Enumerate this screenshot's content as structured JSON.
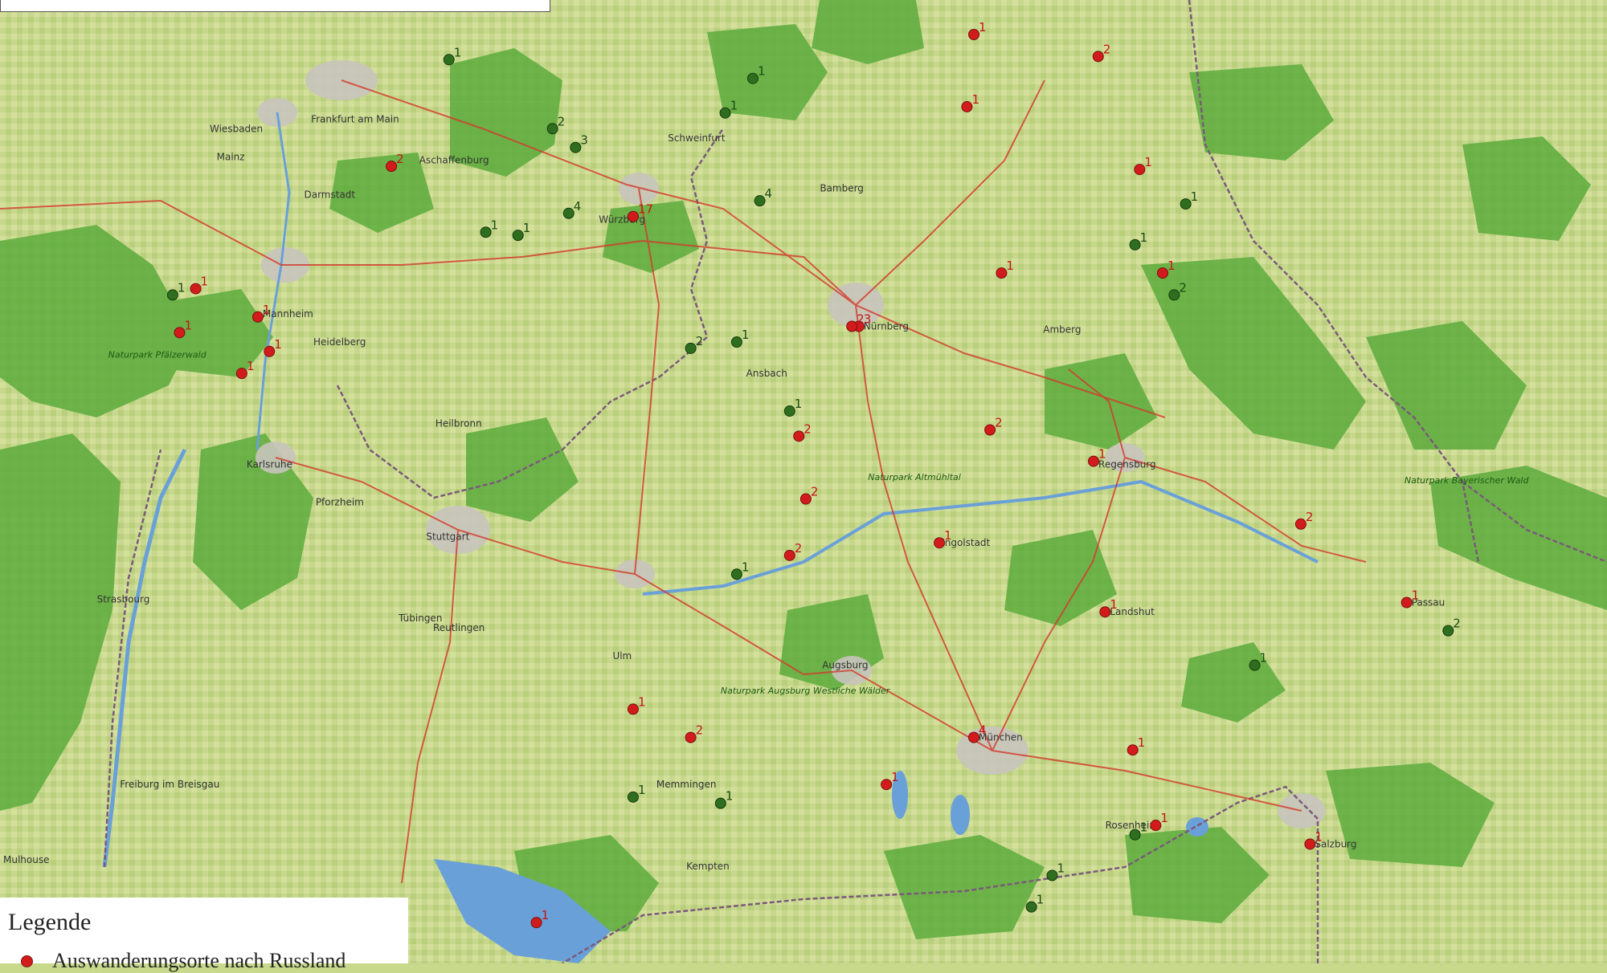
{
  "colors": {
    "russia_marker": "#d21c1c",
    "other_marker": "#2e6e1e",
    "forest": "#5cab3c",
    "farmland": "#c4d68a",
    "lake": "#6aa0d8",
    "road": "#d33a2c",
    "border": "#7a5a7a"
  },
  "legend": {
    "title": "Legende",
    "items": [
      {
        "label": "Auswanderungsorte nach Russland",
        "color": "#d21c1c"
      }
    ]
  },
  "places": [
    {
      "name": "Frankfurt am Main"
    },
    {
      "name": "Wiesbaden"
    },
    {
      "name": "Mainz"
    },
    {
      "name": "Darmstadt"
    },
    {
      "name": "Mannheim"
    },
    {
      "name": "Heidelberg"
    },
    {
      "name": "Karlsruhe"
    },
    {
      "name": "Pforzheim"
    },
    {
      "name": "Stuttgart"
    },
    {
      "name": "Heilbronn"
    },
    {
      "name": "Reutlingen"
    },
    {
      "name": "Tübingen"
    },
    {
      "name": "Strasbourg"
    },
    {
      "name": "Freiburg im Breisgau"
    },
    {
      "name": "Mulhouse"
    },
    {
      "name": "Ulm"
    },
    {
      "name": "Augsburg"
    },
    {
      "name": "München"
    },
    {
      "name": "Ingolstadt"
    },
    {
      "name": "Regensburg"
    },
    {
      "name": "Nürnberg"
    },
    {
      "name": "Würzburg"
    },
    {
      "name": "Bamberg"
    },
    {
      "name": "Landshut"
    },
    {
      "name": "Passau"
    },
    {
      "name": "Salzburg"
    },
    {
      "name": "Kempten"
    },
    {
      "name": "Memmingen"
    },
    {
      "name": "Rosenheim"
    },
    {
      "name": "Amberg"
    },
    {
      "name": "Schweinfurt"
    },
    {
      "name": "Aschaffenburg"
    },
    {
      "name": "Ansbach"
    }
  ],
  "area_labels": [
    {
      "name": "Naturpark Pfälzerwald"
    },
    {
      "name": "Naturpark Altmühltal"
    },
    {
      "name": "Naturpark Bayerischer Wald"
    },
    {
      "name": "Naturpark Augsburg Westliche Wälder"
    }
  ],
  "markers": [
    {
      "kind": "russia",
      "count": 17,
      "x": 10.1,
      "y": 49.8
    },
    {
      "kind": "russia",
      "count": 4,
      "x": 11.58,
      "y": 48.14
    },
    {
      "kind": "russia",
      "count": 3,
      "x": 11.08,
      "y": 49.45
    },
    {
      "kind": "russia",
      "count": 2,
      "x": 11.05,
      "y": 49.45
    },
    {
      "kind": "russia",
      "count": 2,
      "x": 9.05,
      "y": 49.96
    },
    {
      "kind": "russia",
      "count": 2,
      "x": 12.12,
      "y": 50.31
    },
    {
      "kind": "russia",
      "count": 2,
      "x": 11.65,
      "y": 49.12
    },
    {
      "kind": "russia",
      "count": 2,
      "x": 10.78,
      "y": 48.72
    },
    {
      "kind": "russia",
      "count": 2,
      "x": 13.0,
      "y": 48.82
    },
    {
      "kind": "russia",
      "count": 2,
      "x": 10.35,
      "y": 48.14
    },
    {
      "kind": "russia",
      "count": 2,
      "x": 10.85,
      "y": 48.9
    },
    {
      "kind": "russia",
      "count": 2,
      "x": 10.82,
      "y": 49.1
    },
    {
      "kind": "russia",
      "count": 1,
      "x": 8.47,
      "y": 49.48
    },
    {
      "kind": "russia",
      "count": 1,
      "x": 8.2,
      "y": 49.57
    },
    {
      "kind": "russia",
      "count": 1,
      "x": 8.4,
      "y": 49.3
    },
    {
      "kind": "russia",
      "count": 1,
      "x": 8.13,
      "y": 49.43
    },
    {
      "kind": "russia",
      "count": 1,
      "x": 8.52,
      "y": 49.37
    },
    {
      "kind": "russia",
      "count": 1,
      "x": 12.1,
      "y": 49.02
    },
    {
      "kind": "russia",
      "count": 1,
      "x": 11.43,
      "y": 48.76
    },
    {
      "kind": "russia",
      "count": 1,
      "x": 12.15,
      "y": 48.54
    },
    {
      "kind": "russia",
      "count": 1,
      "x": 13.46,
      "y": 48.57
    },
    {
      "kind": "russia",
      "count": 1,
      "x": 13.04,
      "y": 47.8
    },
    {
      "kind": "russia",
      "count": 1,
      "x": 9.68,
      "y": 47.55
    },
    {
      "kind": "russia",
      "count": 1,
      "x": 12.37,
      "y": 47.86
    },
    {
      "kind": "russia",
      "count": 1,
      "x": 12.27,
      "y": 48.1
    },
    {
      "kind": "russia",
      "count": 1,
      "x": 10.1,
      "y": 48.23
    },
    {
      "kind": "russia",
      "count": 1,
      "x": 11.7,
      "y": 49.62
    },
    {
      "kind": "russia",
      "count": 1,
      "x": 12.3,
      "y": 49.95
    },
    {
      "kind": "russia",
      "count": 1,
      "x": 11.55,
      "y": 50.15
    },
    {
      "kind": "russia",
      "count": 1,
      "x": 11.58,
      "y": 50.38
    },
    {
      "kind": "russia",
      "count": 1,
      "x": 12.4,
      "y": 49.62
    },
    {
      "kind": "russia",
      "count": 1,
      "x": 11.2,
      "y": 47.99
    }
  ],
  "other_markers": [
    {
      "kind": "other",
      "count": 4,
      "x": 10.65,
      "y": 49.85
    },
    {
      "kind": "other",
      "count": 4,
      "x": 9.82,
      "y": 49.81
    },
    {
      "kind": "other",
      "count": 3,
      "x": 9.85,
      "y": 50.02
    },
    {
      "kind": "other",
      "count": 2,
      "x": 9.75,
      "y": 50.08
    },
    {
      "kind": "other",
      "count": 2,
      "x": 12.45,
      "y": 49.55
    },
    {
      "kind": "other",
      "count": 2,
      "x": 10.35,
      "y": 49.38
    },
    {
      "kind": "other",
      "count": 2,
      "x": 13.64,
      "y": 48.48
    },
    {
      "kind": "other",
      "count": 1,
      "x": 8.1,
      "y": 49.55
    },
    {
      "kind": "other",
      "count": 1,
      "x": 9.6,
      "y": 49.74
    },
    {
      "kind": "other",
      "count": 1,
      "x": 9.46,
      "y": 49.75
    },
    {
      "kind": "other",
      "count": 1,
      "x": 10.55,
      "y": 49.4
    },
    {
      "kind": "other",
      "count": 1,
      "x": 10.78,
      "y": 49.18
    },
    {
      "kind": "other",
      "count": 1,
      "x": 10.55,
      "y": 48.66
    },
    {
      "kind": "other",
      "count": 1,
      "x": 12.8,
      "y": 48.37
    },
    {
      "kind": "other",
      "count": 1,
      "x": 10.1,
      "y": 47.95
    },
    {
      "kind": "other",
      "count": 1,
      "x": 10.48,
      "y": 47.93
    },
    {
      "kind": "other",
      "count": 1,
      "x": 11.92,
      "y": 47.7
    },
    {
      "kind": "other",
      "count": 1,
      "x": 11.83,
      "y": 47.6
    },
    {
      "kind": "other",
      "count": 1,
      "x": 12.28,
      "y": 47.83
    },
    {
      "kind": "other",
      "count": 1,
      "x": 10.62,
      "y": 50.24
    },
    {
      "kind": "other",
      "count": 1,
      "x": 10.5,
      "y": 50.13
    },
    {
      "kind": "other",
      "count": 1,
      "x": 12.28,
      "y": 49.71
    },
    {
      "kind": "other",
      "count": 1,
      "x": 12.5,
      "y": 49.84
    },
    {
      "kind": "other",
      "count": 1,
      "x": 9.3,
      "y": 50.3
    }
  ]
}
